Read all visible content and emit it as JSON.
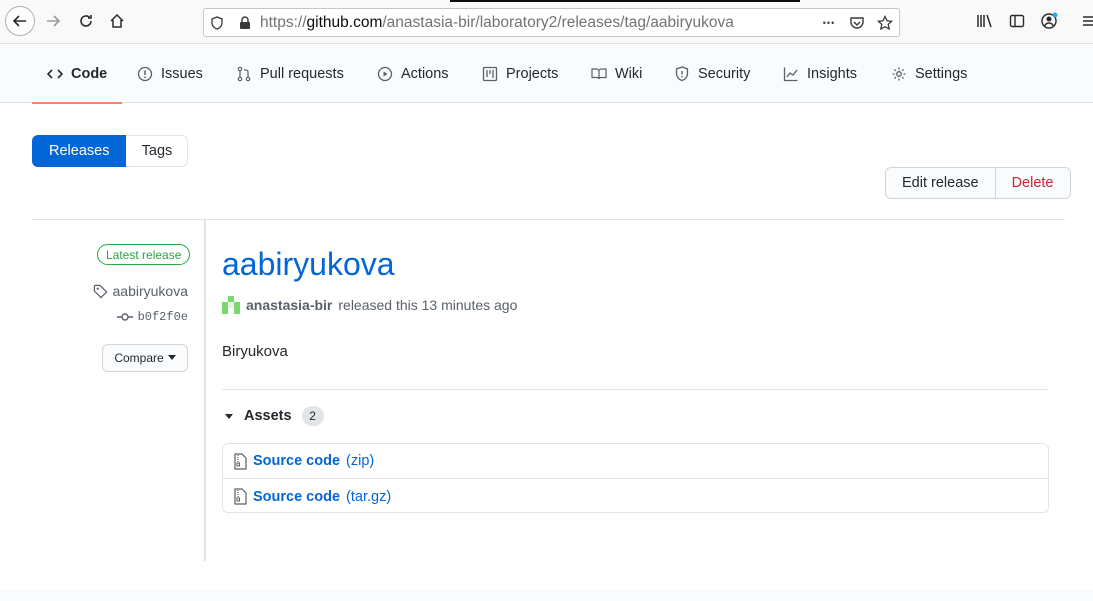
{
  "browser": {
    "url_prefix": "https://",
    "url_host": "github.com",
    "url_path": "/anastasia-bir/laboratory2/releases/tag/aabiryukova",
    "more_glyph": "•••"
  },
  "repo_nav": {
    "code": "Code",
    "issues": "Issues",
    "pull_requests": "Pull requests",
    "actions": "Actions",
    "projects": "Projects",
    "wiki": "Wiki",
    "security": "Security",
    "insights": "Insights",
    "settings": "Settings"
  },
  "subnav": {
    "releases": "Releases",
    "tags": "Tags"
  },
  "actions": {
    "edit": "Edit release",
    "delete": "Delete"
  },
  "meta": {
    "badge": "Latest release",
    "tag": "aabiryukova",
    "commit": "b0f2f0e",
    "compare": "Compare"
  },
  "release": {
    "title": "aabiryukova",
    "author": "anastasia-bir",
    "released_text": "released this 13 minutes ago",
    "body": "Biryukova"
  },
  "assets": {
    "label": "Assets",
    "count": "2",
    "items": [
      {
        "name": "Source code",
        "ext": "(zip)"
      },
      {
        "name": "Source code",
        "ext": "(tar.gz)"
      }
    ]
  },
  "colors": {
    "accent": "#0366d6",
    "danger": "#cb2431",
    "success": "#28a745",
    "tab_underline": "#f9826c"
  }
}
